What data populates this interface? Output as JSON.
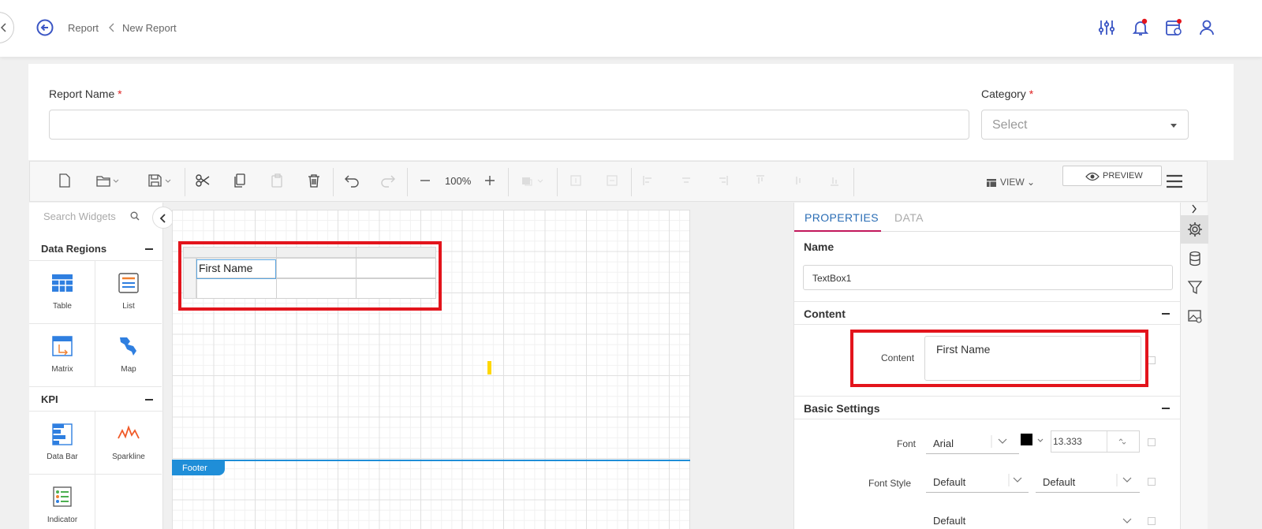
{
  "header": {
    "breadcrumb": [
      "Report",
      "New Report"
    ]
  },
  "form": {
    "report_name_label": "Report Name",
    "category_label": "Category",
    "required_mark": "*",
    "category_placeholder": "Select"
  },
  "toolbar": {
    "zoom": "100%",
    "view_label": "VIEW",
    "preview_label": "PREVIEW"
  },
  "widgets": {
    "search_placeholder": "Search Widgets",
    "sections": [
      {
        "title": "Data Regions",
        "items": [
          "Table",
          "List",
          "Matrix",
          "Map"
        ]
      },
      {
        "title": "KPI",
        "items": [
          "Data Bar",
          "Sparkline",
          "Indicator"
        ]
      }
    ]
  },
  "canvas": {
    "cell_text": "First Name",
    "footer_label": "Footer"
  },
  "properties": {
    "tabs": [
      "PROPERTIES",
      "DATA"
    ],
    "name_label": "Name",
    "name_value": "TextBox1",
    "content_section": "Content",
    "content_label": "Content",
    "content_value": "First Name",
    "basic_section": "Basic Settings",
    "font_label": "Font",
    "font_value": "Arial",
    "font_size": "13.333",
    "font_style_label": "Font Style",
    "font_style_value": "Default",
    "font_weight_value": "Default",
    "next_row_value": "Default"
  },
  "colors": {
    "accent": "#2a6db5",
    "active_tab_underline": "#c2185b",
    "highlight": "#e3141c",
    "footer": "#1f8ed8"
  }
}
